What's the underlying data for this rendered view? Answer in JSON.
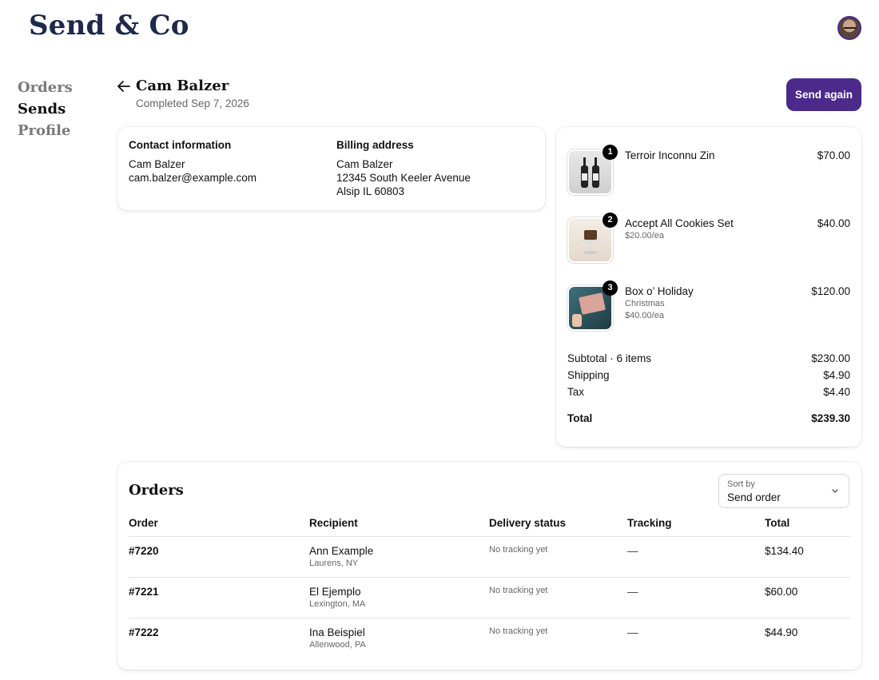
{
  "brand": "Send & Co",
  "nav": {
    "orders": "Orders",
    "sends": "Sends",
    "profile": "Profile"
  },
  "header": {
    "title": "Cam Balzer",
    "subtitle": "Completed Sep 7, 2026",
    "send_again": "Send again"
  },
  "contact": {
    "heading": "Contact information",
    "name": "Cam Balzer",
    "email": "cam.balzer@example.com"
  },
  "billing": {
    "heading": "Billing address",
    "name": "Cam Balzer",
    "street": "12345 South Keeler Avenue",
    "city": "Alsip IL 60803"
  },
  "items": [
    {
      "qty": "1",
      "name": "Terroir Inconnu Zin",
      "price": "$70.00",
      "sub1": "",
      "sub2": ""
    },
    {
      "qty": "2",
      "name": "Accept All Cookies Set",
      "price": "$40.00",
      "sub1": "$20.00/ea",
      "sub2": ""
    },
    {
      "qty": "3",
      "name": "Box o’ Holiday",
      "price": "$120.00",
      "sub1": "Christmas",
      "sub2": "$40.00/ea"
    }
  ],
  "summary": {
    "subtotal_label": "Subtotal · 6 items",
    "subtotal": "$230.00",
    "shipping_label": "Shipping",
    "shipping": "$4.90",
    "tax_label": "Tax",
    "tax": "$4.40",
    "total_label": "Total",
    "total": "$239.30"
  },
  "orders": {
    "title": "Orders",
    "sort_label": "Sort by",
    "sort_value": "Send order",
    "columns": [
      "Order",
      "Recipient",
      "Delivery status",
      "Tracking",
      "Total"
    ],
    "rows": [
      {
        "order": "#7220",
        "recipient": "Ann Example",
        "location": "Laurens, NY",
        "status": "No tracking yet",
        "tracking": "—",
        "total": "$134.40"
      },
      {
        "order": "#7221",
        "recipient": "El Ejemplo",
        "location": "Lexington, MA",
        "status": "No tracking yet",
        "tracking": "—",
        "total": "$60.00"
      },
      {
        "order": "#7222",
        "recipient": "Ina Beispiel",
        "location": "Allenwood, PA",
        "status": "No tracking yet",
        "tracking": "—",
        "total": "$44.90"
      }
    ]
  },
  "colors": {
    "brand_text": "#1f2a4a",
    "accent": "#4b2a8c"
  }
}
